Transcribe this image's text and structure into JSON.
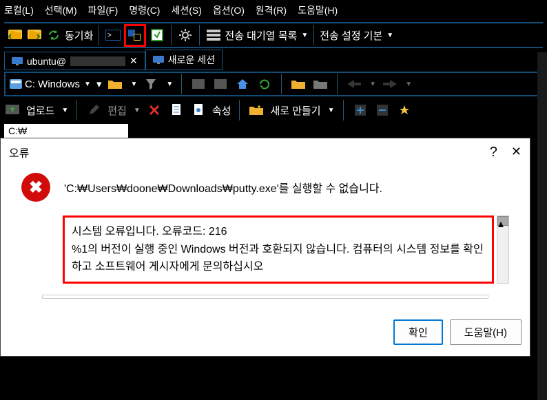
{
  "menubar": [
    "로컬(L)",
    "선택(M)",
    "파일(F)",
    "명령(C)",
    "세션(S)",
    "옵션(O)",
    "원격(R)",
    "도움말(H)"
  ],
  "toolbar1": {
    "sync": "동기화",
    "queue": "전송 대기열 목록",
    "settings_label": "전송 설정",
    "settings_value": "기본"
  },
  "tabs": {
    "active": "ubuntu@",
    "new": "새로운 세션"
  },
  "drive": "C: Windows",
  "toolbar3": {
    "upload": "업로드",
    "edit": "편집",
    "props": "속성",
    "new": "새로 만들기"
  },
  "path": "C:₩",
  "dialog": {
    "title": "오류",
    "help_glyph": "?",
    "close_glyph": "✕",
    "message": "'C:₩Users₩doone₩Downloads₩putty.exe'를 실행할 수 없습니다.",
    "detail_l1": "시스템 오류입니다. 오류코드: 216",
    "detail_l2": "%1의 버전이 실행 중인 Windows 버전과 호환되지 않습니다. 컴퓨터의 시스템 정보를 확인하고 소프트웨어 게시자에게 문의하십시오",
    "ok": "확인",
    "help_btn": "도움말(H)"
  }
}
